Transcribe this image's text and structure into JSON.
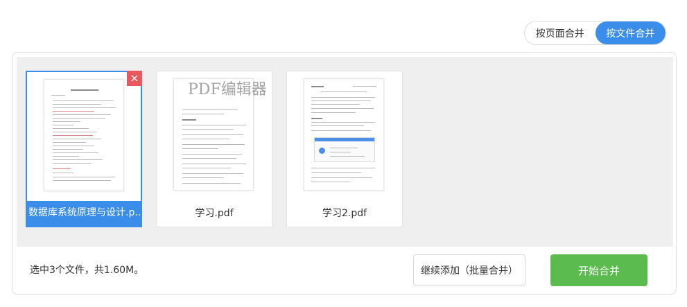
{
  "merge_mode": {
    "by_page_label": "按页面合并",
    "by_file_label": "按文件合并",
    "active": "by_file"
  },
  "files": [
    {
      "name": "数据库系统原理与设计.pdf",
      "display_name": "数据库系统原理与设计.p...",
      "selected": true
    },
    {
      "name": "学习.pdf",
      "display_name": "学习.pdf",
      "selected": false
    },
    {
      "name": "学习2.pdf",
      "display_name": "学习2.pdf",
      "selected": false
    }
  ],
  "thumbnail_watermark": "PDF编辑器",
  "close_icon": "×",
  "footer": {
    "summary": "选中3个文件，共1.60M。",
    "add_more_label": "继续添加（批量合并）",
    "start_label": "开始合并"
  },
  "colors": {
    "accent": "#3a8eea",
    "start_button": "#5bbb4e",
    "close_button": "#e9575d"
  }
}
